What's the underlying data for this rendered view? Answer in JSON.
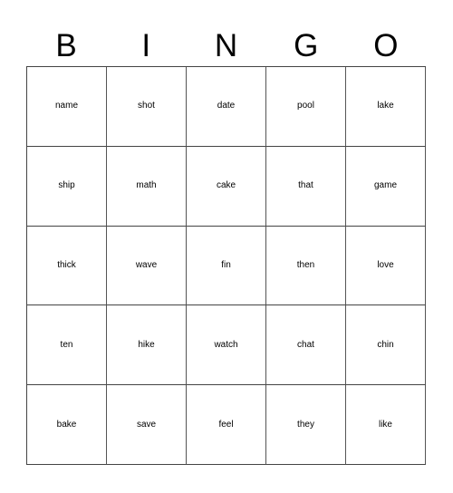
{
  "card": {
    "header": [
      "B",
      "I",
      "N",
      "G",
      "O"
    ],
    "rows": [
      [
        "name",
        "shot",
        "date",
        "pool",
        "lake"
      ],
      [
        "ship",
        "math",
        "cake",
        "that",
        "game"
      ],
      [
        "thick",
        "wave",
        "fin",
        "then",
        "love"
      ],
      [
        "ten",
        "hike",
        "watch",
        "chat",
        "chin"
      ],
      [
        "bake",
        "save",
        "feel",
        "they",
        "like"
      ]
    ]
  }
}
